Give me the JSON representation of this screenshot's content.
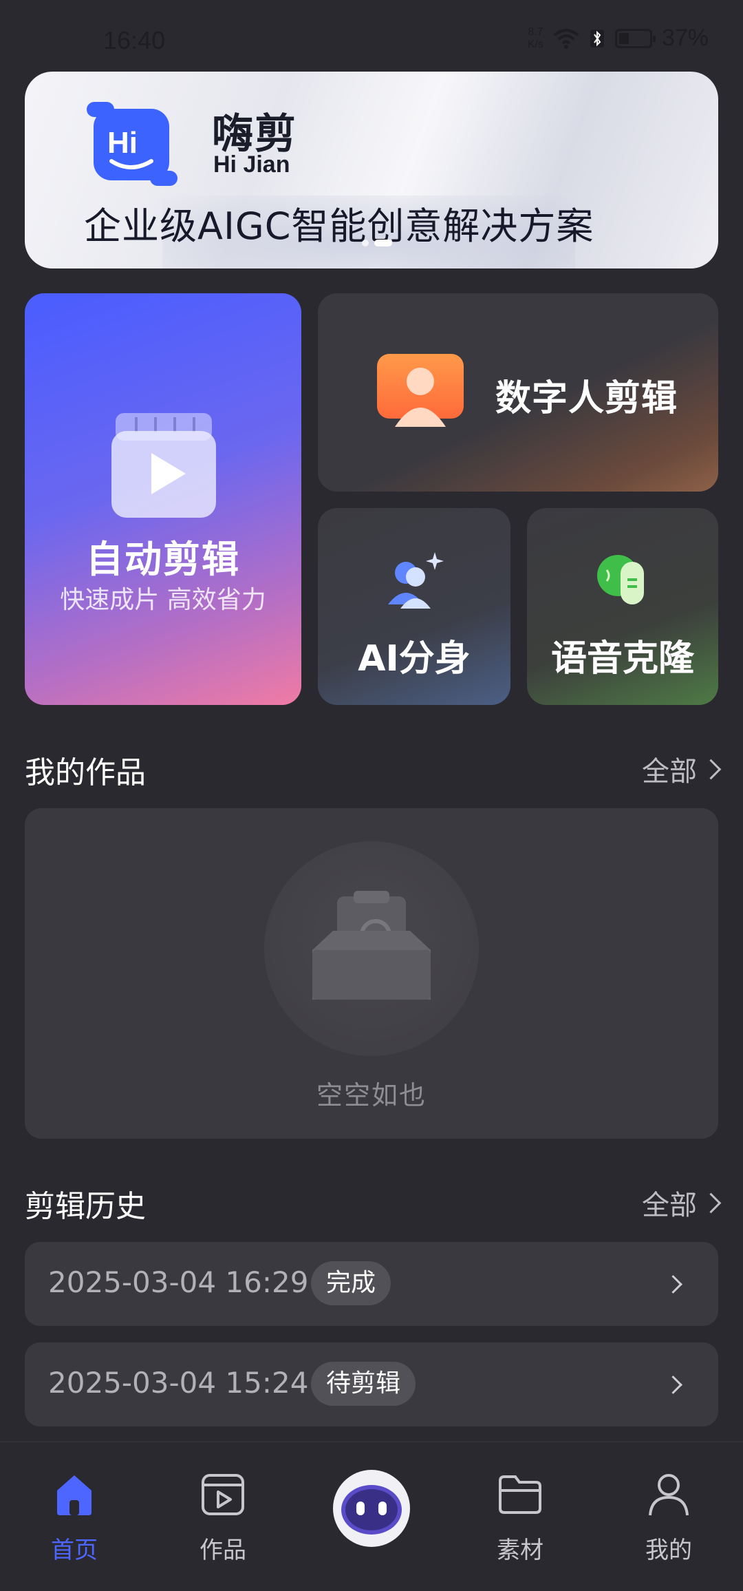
{
  "status_bar": {
    "time": "16:40",
    "net_speed_value": "8.7",
    "net_speed_unit": "K/s",
    "battery": "37%",
    "icons": [
      "wifi-icon",
      "bluetooth-icon",
      "battery-icon"
    ]
  },
  "banner": {
    "logo_zh": "嗨剪",
    "logo_en": "Hi Jian",
    "slogan": "企业级AIGC智能创意解决方案",
    "carousel_index": 1,
    "carousel_count": 2
  },
  "features": {
    "auto_edit": {
      "title": "自动剪辑",
      "subtitle": "快速成片 高效省力",
      "icon": "video-play-icon"
    },
    "digital_human": {
      "title": "数字人剪辑",
      "icon": "digital-human-icon"
    },
    "ai_clone": {
      "title": "AI分身",
      "icon": "ai-avatar-icon"
    },
    "voice_clone": {
      "title": "语音克隆",
      "icon": "voice-icon"
    }
  },
  "works": {
    "title": "我的作品",
    "more": "全部",
    "empty_text": "空空如也"
  },
  "history": {
    "title": "剪辑历史",
    "more": "全部",
    "items": [
      {
        "date": "2025-03-04 16:29",
        "status": "完成"
      },
      {
        "date": "2025-03-04 15:24",
        "status": "待剪辑"
      }
    ]
  },
  "tabbar": {
    "items": [
      {
        "label": "首页",
        "icon": "home-icon",
        "active": true
      },
      {
        "label": "作品",
        "icon": "works-icon",
        "active": false
      },
      {
        "label": "",
        "icon": "robot-assistant-icon",
        "active": false
      },
      {
        "label": "素材",
        "icon": "folder-icon",
        "active": false
      },
      {
        "label": "我的",
        "icon": "user-icon",
        "active": false
      }
    ]
  },
  "colors": {
    "background": "#2a292f",
    "panel": "#3a393f",
    "accent": "#4d66ff"
  }
}
